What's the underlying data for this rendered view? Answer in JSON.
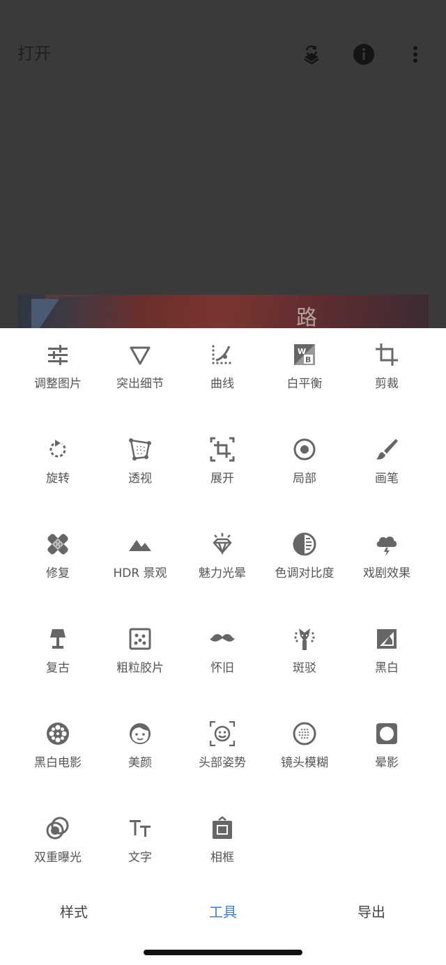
{
  "header": {
    "title": "打开",
    "icons": [
      "layers-undo-icon",
      "info-icon",
      "more-vertical-icon"
    ]
  },
  "tools": [
    {
      "label": "调整图片",
      "icon": "tune-sliders-icon"
    },
    {
      "label": "突出细节",
      "icon": "triangle-details-icon"
    },
    {
      "label": "曲线",
      "icon": "curves-icon"
    },
    {
      "label": "白平衡",
      "icon": "white-balance-icon"
    },
    {
      "label": "剪裁",
      "icon": "crop-icon"
    },
    {
      "label": "旋转",
      "icon": "rotate-icon"
    },
    {
      "label": "透视",
      "icon": "perspective-icon"
    },
    {
      "label": "展开",
      "icon": "expand-icon"
    },
    {
      "label": "局部",
      "icon": "selective-icon"
    },
    {
      "label": "画笔",
      "icon": "brush-icon"
    },
    {
      "label": "修复",
      "icon": "healing-bandage-icon"
    },
    {
      "label": "HDR 景观",
      "icon": "mountains-icon"
    },
    {
      "label": "魅力光晕",
      "icon": "glamour-diamond-icon"
    },
    {
      "label": "色调对比度",
      "icon": "tonal-contrast-icon"
    },
    {
      "label": "戏剧效果",
      "icon": "drama-cloud-icon"
    },
    {
      "label": "复古",
      "icon": "vintage-lamp-icon"
    },
    {
      "label": "粗粒胶片",
      "icon": "grainy-film-icon"
    },
    {
      "label": "怀旧",
      "icon": "mustache-icon"
    },
    {
      "label": "斑驳",
      "icon": "grunge-guitar-icon"
    },
    {
      "label": "黑白",
      "icon": "black-white-icon"
    },
    {
      "label": "黑白电影",
      "icon": "film-reel-icon"
    },
    {
      "label": "美颜",
      "icon": "face-icon"
    },
    {
      "label": "头部姿势",
      "icon": "head-pose-icon"
    },
    {
      "label": "镜头模糊",
      "icon": "lens-blur-icon"
    },
    {
      "label": "晕影",
      "icon": "vignette-icon"
    },
    {
      "label": "双重曝光",
      "icon": "double-exposure-icon"
    },
    {
      "label": "文字",
      "icon": "text-icon"
    },
    {
      "label": "相框",
      "icon": "frame-icon"
    }
  ],
  "nav": {
    "styles": "样式",
    "tools": "工具",
    "export": "导出",
    "active": "工具"
  },
  "colors": {
    "accent": "#3b7de0",
    "icon": "#666666",
    "overlay": "#3a3a3a"
  }
}
